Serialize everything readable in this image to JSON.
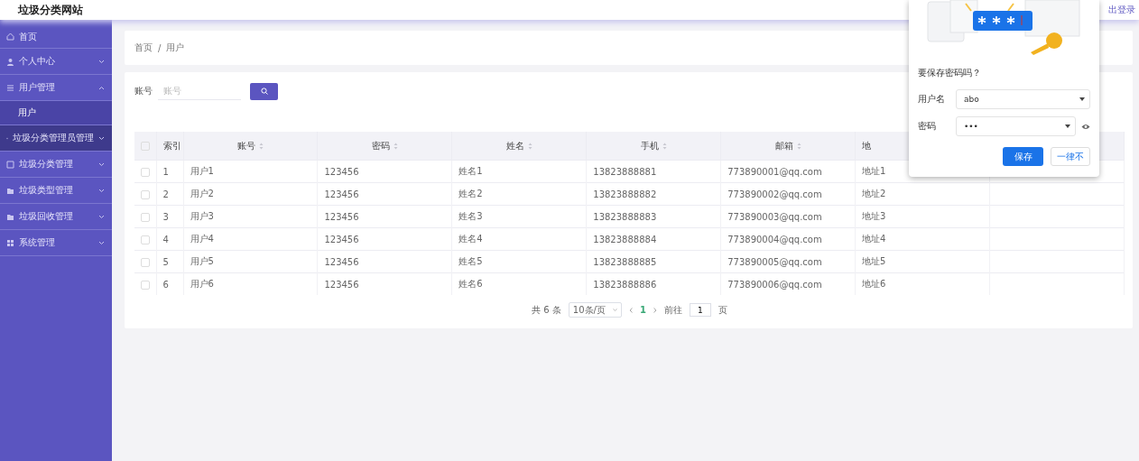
{
  "header": {
    "title": "垃圾分类网站",
    "logout": "出登录"
  },
  "sidebar": {
    "items": [
      {
        "label": "首页",
        "kind": "link",
        "selected": false,
        "hovered": false
      },
      {
        "label": "个人中心",
        "kind": "menu",
        "expanded": false,
        "selected": false,
        "hovered": false
      },
      {
        "label": "用户管理",
        "kind": "menu",
        "expanded": true,
        "selected": false,
        "hovered": false,
        "children": [
          {
            "label": "用户",
            "selected": true
          }
        ]
      },
      {
        "label": "垃圾分类管理员管理",
        "kind": "menu",
        "expanded": false,
        "selected": false,
        "hovered": true
      },
      {
        "label": "垃圾分类管理",
        "kind": "menu",
        "expanded": false,
        "selected": false,
        "hovered": false
      },
      {
        "label": "垃圾类型管理",
        "kind": "menu",
        "expanded": false,
        "selected": false,
        "hovered": false
      },
      {
        "label": "垃圾回收管理",
        "kind": "menu",
        "expanded": false,
        "selected": false,
        "hovered": false
      },
      {
        "label": "系统管理",
        "kind": "menu",
        "expanded": false,
        "selected": false,
        "hovered": false
      }
    ]
  },
  "breadcrumb": {
    "items": [
      "首页",
      "用户"
    ],
    "separator": "/"
  },
  "search": {
    "label": "账号",
    "placeholder": "账号"
  },
  "table": {
    "header_checked": false,
    "columns": [
      {
        "label": "索引",
        "sortable": false
      },
      {
        "label": "账号",
        "sortable": true
      },
      {
        "label": "密码",
        "sortable": true
      },
      {
        "label": "姓名",
        "sortable": true
      },
      {
        "label": "手机",
        "sortable": true
      },
      {
        "label": "邮箱",
        "sortable": true
      },
      {
        "label": "地"
      }
    ],
    "rows": [
      {
        "checked": false,
        "cells": [
          "1",
          "用户1",
          "123456",
          "姓名1",
          "13823888881",
          "773890001@qq.com",
          "地址1"
        ]
      },
      {
        "checked": false,
        "cells": [
          "2",
          "用户2",
          "123456",
          "姓名2",
          "13823888882",
          "773890002@qq.com",
          "地址2"
        ]
      },
      {
        "checked": false,
        "cells": [
          "3",
          "用户3",
          "123456",
          "姓名3",
          "13823888883",
          "773890003@qq.com",
          "地址3"
        ]
      },
      {
        "checked": false,
        "cells": [
          "4",
          "用户4",
          "123456",
          "姓名4",
          "13823888884",
          "773890004@qq.com",
          "地址4"
        ]
      },
      {
        "checked": false,
        "cells": [
          "5",
          "用户5",
          "123456",
          "姓名5",
          "13823888885",
          "773890005@qq.com",
          "地址5"
        ]
      },
      {
        "checked": false,
        "cells": [
          "6",
          "用户6",
          "123456",
          "姓名6",
          "13823888886",
          "773890006@qq.com",
          "地址6"
        ]
      }
    ]
  },
  "pagination": {
    "total": "共 6 条",
    "page_size": "10条/页",
    "pages": [
      {
        "label": "1",
        "selected": true
      }
    ],
    "goto_label": "前往",
    "goto_value": "1",
    "goto_suffix": "页"
  },
  "save_password_popup": {
    "title": "要保存密码吗？",
    "username_label": "用户名",
    "username": "abo",
    "password_label": "密码",
    "password": "•••",
    "buttons": [
      {
        "label": "保存",
        "kind": "primary"
      },
      {
        "label": "一律不",
        "kind": "secondary"
      }
    ]
  }
}
